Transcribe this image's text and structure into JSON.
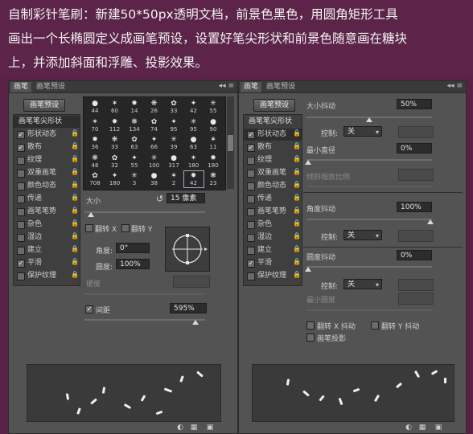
{
  "caption": {
    "line1": "自制彩针笔刷：新建50*50px透明文档，前景色黑色，用圆角矩形工具",
    "line2": "画出一个长椭圆定义成画笔预设，设置好笔尖形状和前景色随意画在糖块",
    "line3": "上，并添加斜面和浮雕、投影效果。"
  },
  "left_panel": {
    "tab_active": "画笔",
    "tab_other": "画笔预设",
    "tab_controls": "◂◂ ≡",
    "preset_button": "画笔预设",
    "list_header": "画笔笔尖形状",
    "options": [
      {
        "label": "形状动态",
        "checked": true
      },
      {
        "label": "散布",
        "checked": true
      },
      {
        "label": "纹理",
        "checked": false
      },
      {
        "label": "双重画笔",
        "checked": false
      },
      {
        "label": "颜色动态",
        "checked": false
      },
      {
        "label": "传递",
        "checked": false
      },
      {
        "label": "画笔笔势",
        "checked": false
      },
      {
        "label": "杂色",
        "checked": false
      },
      {
        "label": "湿边",
        "checked": false
      },
      {
        "label": "建立",
        "checked": false
      },
      {
        "label": "平滑",
        "checked": true
      },
      {
        "label": "保护纹理",
        "checked": false
      }
    ],
    "brush_sizes": [
      [
        "44",
        "60",
        "14",
        "26",
        "33",
        "42",
        "55"
      ],
      [
        "70",
        "112",
        "134",
        "74",
        "95",
        "95",
        "90"
      ],
      [
        "36",
        "33",
        "63",
        "66",
        "39",
        "63",
        "11"
      ],
      [
        "48",
        "32",
        "55",
        "100",
        "317",
        "180",
        "180"
      ],
      [
        "708",
        "180",
        "3",
        "38",
        "2",
        "42",
        "23"
      ]
    ],
    "size_label": "大小",
    "size_value": "15 像素",
    "flip_x": "翻转 X",
    "flip_y": "翻转 Y",
    "angle_label": "角度:",
    "angle_value": "0°",
    "roundness_label": "圆度:",
    "roundness_value": "100%",
    "hardness_label": "硬度",
    "spacing_label": "间距",
    "spacing_value": "595%"
  },
  "right_panel": {
    "tab_active": "画笔",
    "tab_other": "画笔预设",
    "tab_controls": "◂◂ ≡",
    "preset_button": "画笔预设",
    "list_header": "画笔笔尖形状",
    "options": [
      {
        "label": "形状动态",
        "checked": true
      },
      {
        "label": "散布",
        "checked": true
      },
      {
        "label": "纹理",
        "checked": false
      },
      {
        "label": "双重画笔",
        "checked": false
      },
      {
        "label": "颜色动态",
        "checked": false
      },
      {
        "label": "传递",
        "checked": false
      },
      {
        "label": "画笔笔势",
        "checked": false
      },
      {
        "label": "杂色",
        "checked": false
      },
      {
        "label": "湿边",
        "checked": false
      },
      {
        "label": "建立",
        "checked": false
      },
      {
        "label": "平滑",
        "checked": true
      },
      {
        "label": "保护纹理",
        "checked": false
      }
    ],
    "size_jitter_label": "大小抖动",
    "size_jitter_value": "50%",
    "control1_label": "控制:",
    "control1_value": "关",
    "min_diameter_label": "最小直径",
    "min_diameter_value": "0%",
    "tilt_scale_label": "倾斜缩放比例",
    "angle_jitter_label": "角度抖动",
    "angle_jitter_value": "100%",
    "control2_label": "控制:",
    "control2_value": "关",
    "roundness_jitter_label": "圆度抖动",
    "roundness_jitter_value": "0%",
    "control3_label": "控制:",
    "control3_value": "关",
    "min_roundness_label": "最小圆度",
    "flip_x_jitter": "翻转 X 抖动",
    "flip_y_jitter": "翻转 Y 抖动",
    "brush_projection": "画笔投影"
  }
}
